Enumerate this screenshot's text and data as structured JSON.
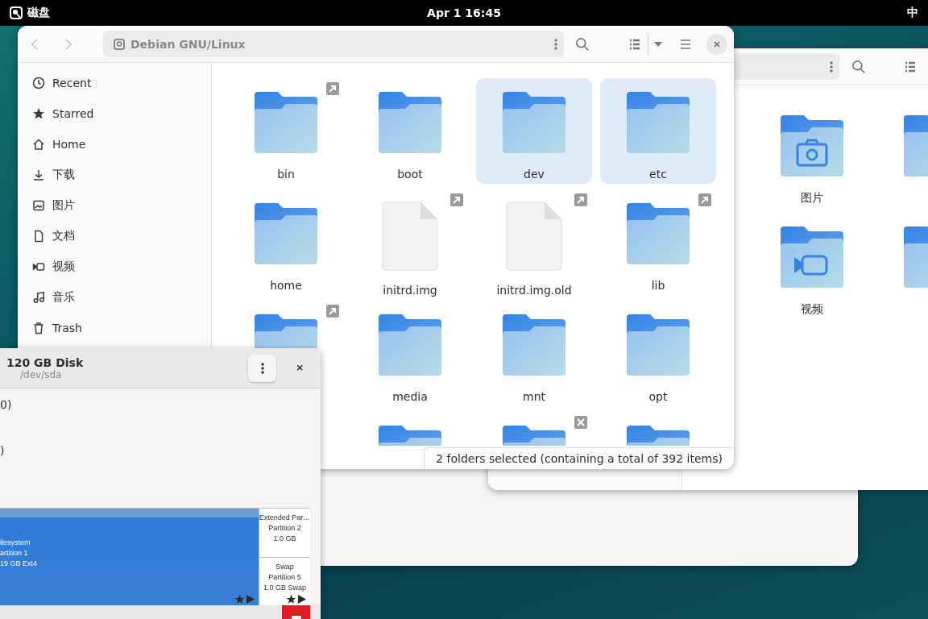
{
  "top_bar": {
    "app": "磁盘",
    "clock": "Apr 1 16:45",
    "input_method": "中"
  },
  "files_window": {
    "location": "Debian GNU/Linux",
    "sidebar": [
      {
        "label": "Recent"
      },
      {
        "label": "Starred"
      },
      {
        "label": "Home"
      },
      {
        "label": "下载"
      },
      {
        "label": "图片"
      },
      {
        "label": "文档"
      },
      {
        "label": "视频"
      },
      {
        "label": "音乐"
      },
      {
        "label": "Trash"
      }
    ],
    "items": [
      {
        "name": "bin",
        "kind": "folder",
        "selected": false,
        "symlink": true
      },
      {
        "name": "boot",
        "kind": "folder",
        "selected": false
      },
      {
        "name": "dev",
        "kind": "folder",
        "selected": true
      },
      {
        "name": "etc",
        "kind": "folder",
        "selected": true
      },
      {
        "name": "home",
        "kind": "folder",
        "selected": false
      },
      {
        "name": "initrd.img",
        "kind": "file",
        "selected": false,
        "symlink": true
      },
      {
        "name": "initrd.img.old",
        "kind": "file",
        "selected": false,
        "symlink": true
      },
      {
        "name": "lib",
        "kind": "folder",
        "selected": false,
        "symlink": true
      },
      {
        "kind": "folder",
        "selected": false,
        "symlink": true
      },
      {
        "name": "media",
        "kind": "folder",
        "selected": false
      },
      {
        "name": "mnt",
        "kind": "folder",
        "selected": false
      },
      {
        "name": "opt",
        "kind": "folder",
        "selected": false
      },
      {
        "kind": "empty"
      },
      {
        "kind": "folder",
        "selected": false
      },
      {
        "kind": "folder",
        "selected": false,
        "unreadable": true
      },
      {
        "kind": "folder",
        "selected": false
      }
    ],
    "status": "2 folders selected  (containing a total of 392 items)"
  },
  "files_window_back": {
    "items": [
      {
        "name": "图片",
        "kind": "pictures"
      },
      {
        "kind": "folder"
      },
      {
        "name": "视频",
        "kind": "videos"
      },
      {
        "kind": "folder"
      }
    ]
  },
  "disk_dialog": {
    "title": "120 GB Disk",
    "subtitle": "/dev/sda",
    "fields": [
      "0)",
      ")"
    ],
    "partitions": [
      {
        "lines": [
          "ilesystem",
          "artition 1",
          "19 GB Ext4"
        ],
        "selected": true,
        "mounted": true
      },
      {
        "lines": [
          "Extended Par…",
          "Partition 2",
          "1.0 GB"
        ],
        "selected": false,
        "mounted": false
      },
      {
        "lines": [
          "Swap",
          "Partition 5",
          "1.0 GB Swap"
        ],
        "selected": false,
        "mounted": true
      }
    ]
  }
}
